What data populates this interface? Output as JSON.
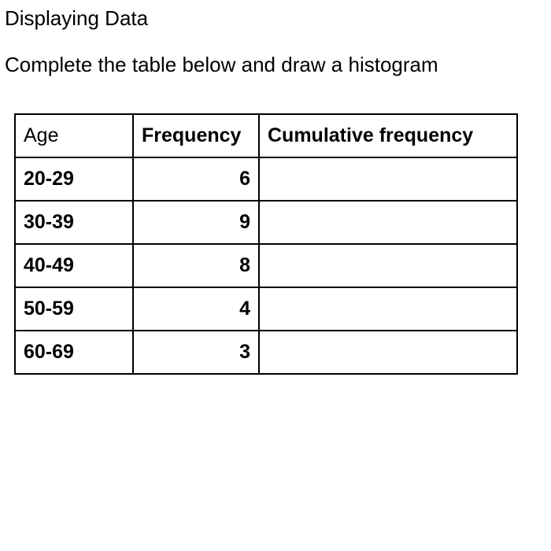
{
  "heading": "Displaying Data",
  "instruction": "Complete the table below and draw a histogram",
  "table": {
    "headers": {
      "age": "Age",
      "frequency": "Frequency",
      "cumulative": "Cumulative frequency"
    },
    "rows": [
      {
        "age": "20-29",
        "frequency": "6",
        "cumulative": ""
      },
      {
        "age": "30-39",
        "frequency": "9",
        "cumulative": ""
      },
      {
        "age": "40-49",
        "frequency": "8",
        "cumulative": ""
      },
      {
        "age": "50-59",
        "frequency": "4",
        "cumulative": ""
      },
      {
        "age": "60-69",
        "frequency": "3",
        "cumulative": ""
      }
    ]
  }
}
